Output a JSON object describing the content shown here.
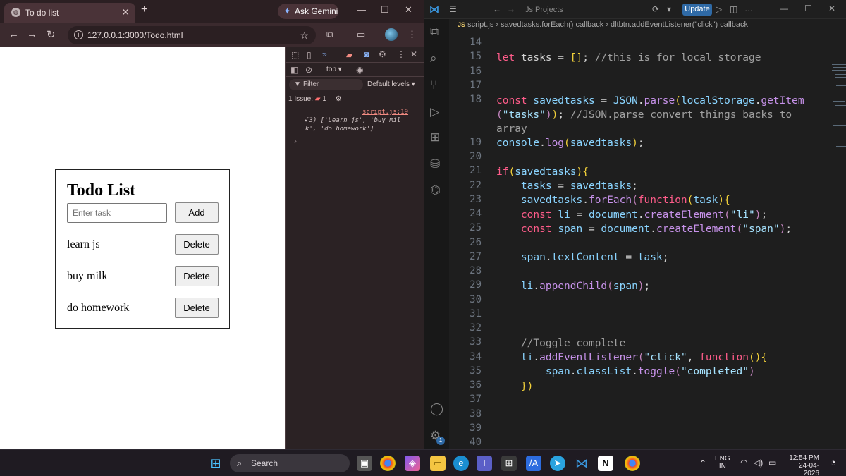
{
  "browser": {
    "tab_title": "To do list",
    "gemini_label": "Ask Gemini",
    "url": "127.0.0.1:3000/Todo.html"
  },
  "page": {
    "heading": "Todo List",
    "input_placeholder": "Enter task",
    "add_label": "Add",
    "tasks": [
      "learn js",
      "buy milk",
      "do homework"
    ],
    "delete_label": "Delete"
  },
  "devtools": {
    "context": "top",
    "filter_label": "Filter",
    "levels_label": "Default levels",
    "issue_label": "1 Issue:",
    "issue_count": "1",
    "log_source": "script.js:19",
    "log_line1": "(3) ['Learn js', 'buy mil",
    "log_line2": "k', 'do homework']"
  },
  "vscode": {
    "search_label": "Js Projects",
    "update_label": "Update",
    "breadcrumb_file": "script.js",
    "breadcrumb_1": "savedtasks.forEach() callback",
    "breadcrumb_2": "dltbtn.addEventListener(\"click\") callback",
    "line_numbers": [
      "14",
      "15",
      "16",
      "17",
      "18",
      "",
      "",
      "19",
      "20",
      "21",
      "22",
      "23",
      "24",
      "25",
      "26",
      "27",
      "28",
      "29",
      "30",
      "31",
      "32",
      "33",
      "34",
      "35",
      "36",
      "37",
      "38",
      "39",
      "40"
    ],
    "settings_badge": "1"
  },
  "taskbar": {
    "search_label": "Search",
    "lang_top": "ENG",
    "lang_bottom": "IN",
    "time": "12:54 PM",
    "date": "24-04-2026"
  }
}
